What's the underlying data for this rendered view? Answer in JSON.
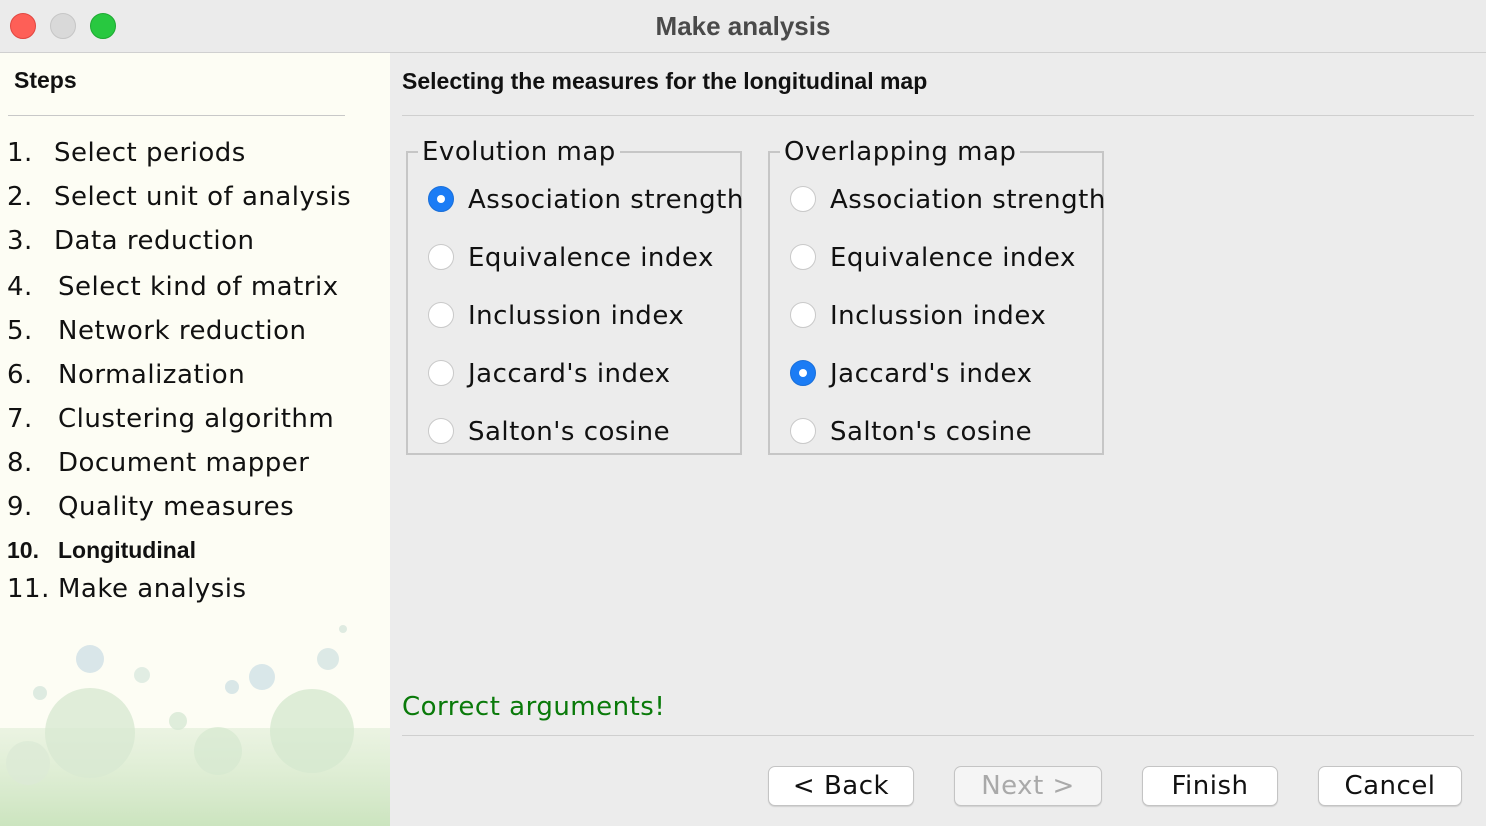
{
  "window": {
    "title": "Make analysis"
  },
  "sidebar": {
    "heading": "Steps",
    "steps": [
      {
        "num": "1.",
        "label": "Select periods"
      },
      {
        "num": "2.",
        "label": "Select unit of analysis"
      },
      {
        "num": "3.",
        "label": "Data reduction"
      },
      {
        "num": "4.",
        "label": "Select kind of matrix"
      },
      {
        "num": "5.",
        "label": "Network reduction"
      },
      {
        "num": "6.",
        "label": "Normalization"
      },
      {
        "num": "7.",
        "label": "Clustering algorithm"
      },
      {
        "num": "8.",
        "label": "Document mapper"
      },
      {
        "num": "9.",
        "label": "Quality measures"
      },
      {
        "num": "10.",
        "label": "Longitudinal"
      },
      {
        "num": "11.",
        "label": "Make analysis"
      }
    ],
    "current_step": "Longitudinal"
  },
  "main": {
    "heading": "Selecting the measures for the longitudinal map",
    "evolution": {
      "title": "Evolution map",
      "options": [
        "Association strength",
        "Equivalence index",
        "Inclussion index",
        "Jaccard's index",
        "Salton's cosine"
      ],
      "selected": "Association strength"
    },
    "overlapping": {
      "title": "Overlapping map",
      "options": [
        "Association strength",
        "Equivalence index",
        "Inclussion index",
        "Jaccard's index",
        "Salton's cosine"
      ],
      "selected": "Jaccard's index"
    },
    "status": "Correct arguments!"
  },
  "buttons": {
    "back": "< Back",
    "next": "Next >",
    "finish": "Finish",
    "cancel": "Cancel"
  },
  "colors": {
    "accent": "#1b7cf5",
    "status_ok": "#0a7a0a",
    "sidebar_bg": "#fdfdf4"
  }
}
